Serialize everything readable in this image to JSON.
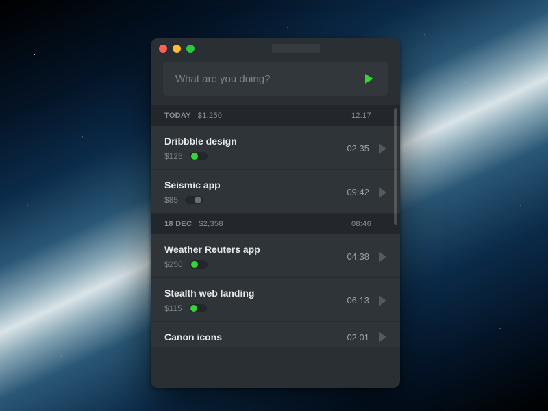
{
  "input": {
    "placeholder": "What are you doing?"
  },
  "sections": [
    {
      "label": "TODAY",
      "amount": "$1,250",
      "time": "12:17",
      "entries": [
        {
          "name": "Dribbble design",
          "price": "$125",
          "billable": true,
          "duration": "02:35"
        },
        {
          "name": "Seismic app",
          "price": "$85",
          "billable": false,
          "duration": "09:42"
        }
      ]
    },
    {
      "label": "18 DEC",
      "amount": "$2,358",
      "time": "08:46",
      "entries": [
        {
          "name": "Weather Reuters app",
          "price": "$250",
          "billable": true,
          "duration": "04:38"
        },
        {
          "name": "Stealth web landing",
          "price": "$115",
          "billable": true,
          "duration": "06:13"
        },
        {
          "name": "Canon icons",
          "price": "",
          "billable": true,
          "duration": "02:01"
        }
      ]
    }
  ]
}
